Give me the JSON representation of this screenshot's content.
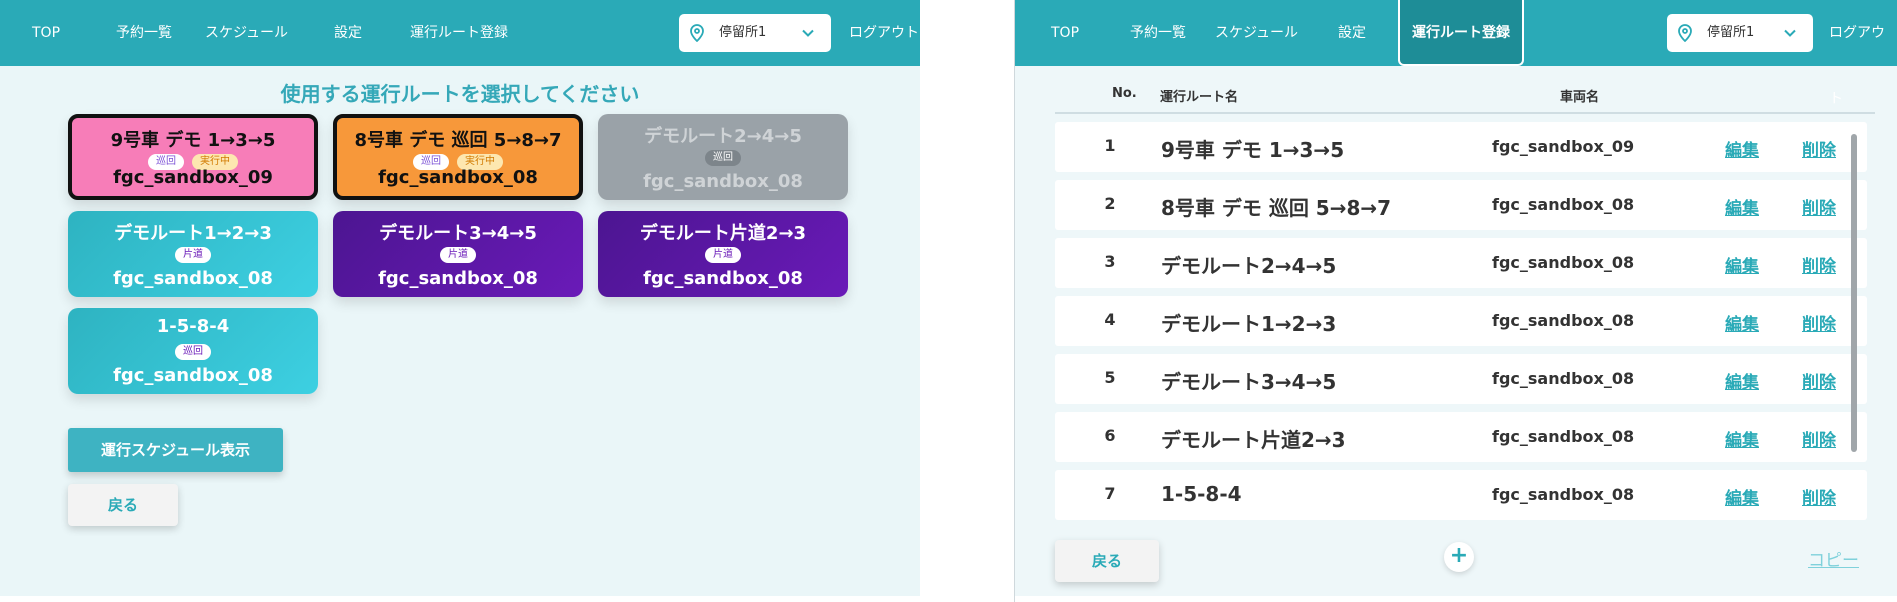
{
  "colors": {
    "accent": "#2aaab7",
    "nav_active": "#1e8d97"
  },
  "left": {
    "nav": {
      "top": "TOP",
      "reservations": "予約一覧",
      "schedule": "スケジュール",
      "settings": "設定",
      "route_register": "運行ルート登録"
    },
    "stop_select": {
      "value": "停留所1",
      "icon": "map-pin-icon"
    },
    "logout": "ログアウト",
    "heading": "使用する運行ルートを選択してください",
    "cards": [
      {
        "title": "9号車 デモ 1→3→5",
        "badges": [
          "巡回",
          "実行中"
        ],
        "vehicle": "fgc_sandbox_09",
        "color": "pink",
        "selected": true
      },
      {
        "title": "8号車 デモ 巡回 5→8→7",
        "badges": [
          "巡回",
          "実行中"
        ],
        "vehicle": "fgc_sandbox_08",
        "color": "orange",
        "selected": true
      },
      {
        "title": "デモルート2→4→5",
        "badges": [
          "巡回"
        ],
        "vehicle": "fgc_sandbox_08",
        "color": "gray",
        "selected": false
      },
      {
        "title": "デモルート1→2→3",
        "badges": [
          "片道"
        ],
        "vehicle": "fgc_sandbox_08",
        "color": "teal",
        "selected": false
      },
      {
        "title": "デモルート3→4→5",
        "badges": [
          "片道"
        ],
        "vehicle": "fgc_sandbox_08",
        "color": "purple",
        "selected": false
      },
      {
        "title": "デモルート片道2→3",
        "badges": [
          "片道"
        ],
        "vehicle": "fgc_sandbox_08",
        "color": "purple",
        "selected": false
      },
      {
        "title": "1-5-8-4",
        "badges": [
          "巡回"
        ],
        "vehicle": "fgc_sandbox_08",
        "color": "teal",
        "selected": false
      }
    ],
    "schedule_button": "運行スケジュール表示",
    "back_button": "戻る"
  },
  "right": {
    "nav": {
      "top": "TOP",
      "reservations": "予約一覧",
      "schedule": "スケジュール",
      "settings": "設定",
      "route_register": "運行ルート登録"
    },
    "stop_select": {
      "value": "停留所1",
      "icon": "map-pin-icon"
    },
    "logout": "ログアウト",
    "table": {
      "headers": {
        "no": "No.",
        "route_name": "運行ルート名",
        "vehicle": "車両名"
      },
      "rows": [
        {
          "no": "1",
          "name": "9号車 デモ 1→3→5",
          "vehicle": "fgc_sandbox_09",
          "edit": "編集",
          "delete": "削除"
        },
        {
          "no": "2",
          "name": "8号車 デモ 巡回 5→8→7",
          "vehicle": "fgc_sandbox_08",
          "edit": "編集",
          "delete": "削除"
        },
        {
          "no": "3",
          "name": "デモルート2→4→5",
          "vehicle": "fgc_sandbox_08",
          "edit": "編集",
          "delete": "削除"
        },
        {
          "no": "4",
          "name": "デモルート1→2→3",
          "vehicle": "fgc_sandbox_08",
          "edit": "編集",
          "delete": "削除"
        },
        {
          "no": "5",
          "name": "デモルート3→4→5",
          "vehicle": "fgc_sandbox_08",
          "edit": "編集",
          "delete": "削除"
        },
        {
          "no": "6",
          "name": "デモルート片道2→3",
          "vehicle": "fgc_sandbox_08",
          "edit": "編集",
          "delete": "削除"
        },
        {
          "no": "7",
          "name": "1-5-8-4",
          "vehicle": "fgc_sandbox_08",
          "edit": "編集",
          "delete": "削除"
        }
      ]
    },
    "back_button": "戻る",
    "add_button": "+",
    "copy_link": "コピー"
  }
}
